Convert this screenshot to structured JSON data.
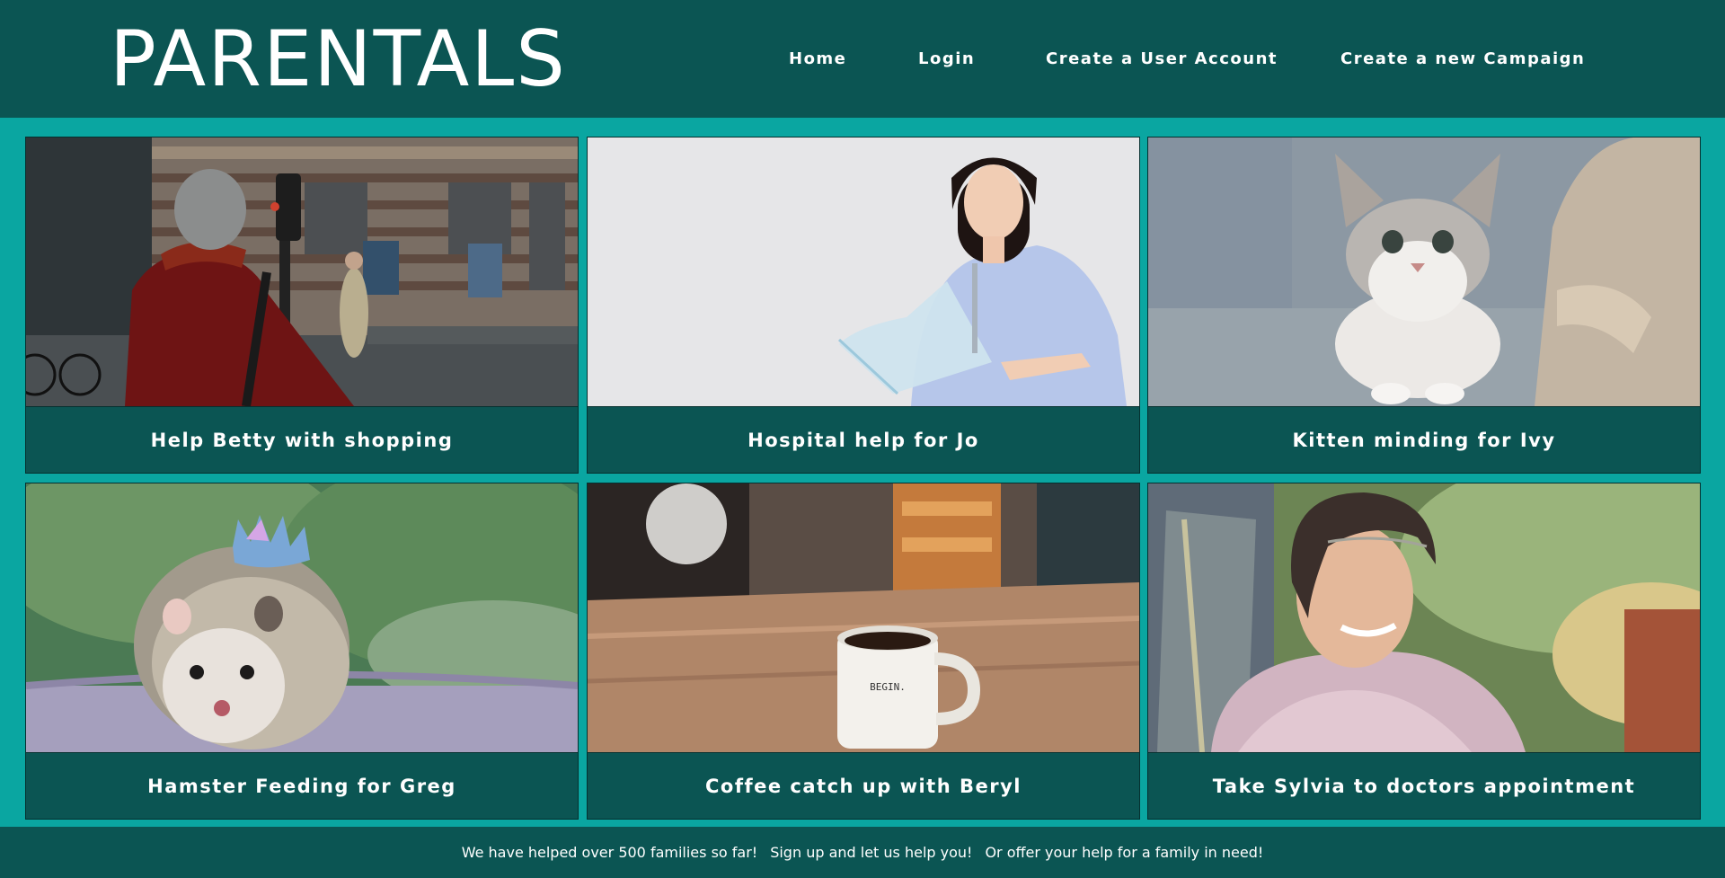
{
  "header": {
    "logo": "PARENTALS",
    "nav": {
      "home": "Home",
      "login": "Login",
      "create_user": "Create a User Account",
      "create_campaign": "Create a new Campaign"
    }
  },
  "campaigns": [
    {
      "title": "Help Betty with shopping",
      "image": "elderly woman in red coat on city street"
    },
    {
      "title": "Hospital help for Jo",
      "image": "woman with arm in sling"
    },
    {
      "title": "Kitten minding for Ivy",
      "image": "grey and white kitten on sofa"
    },
    {
      "title": "Hamster Feeding for Greg",
      "image": "hedgehog wearing a crown"
    },
    {
      "title": "Coffee catch up with Beryl",
      "image": "coffee mug on wooden table"
    },
    {
      "title": "Take Sylvia to doctors appointment",
      "image": "smiling elderly woman in garden"
    }
  ],
  "mug_text": "BEGIN.",
  "footer": {
    "line1": "We have helped over 500 families so far!",
    "line2": "Sign up and let us help you!",
    "line3": "Or offer your help for a family in need!"
  },
  "colors": {
    "header_bg": "#0b5553",
    "page_bg": "#0aa6a1",
    "text": "#ffffff"
  }
}
